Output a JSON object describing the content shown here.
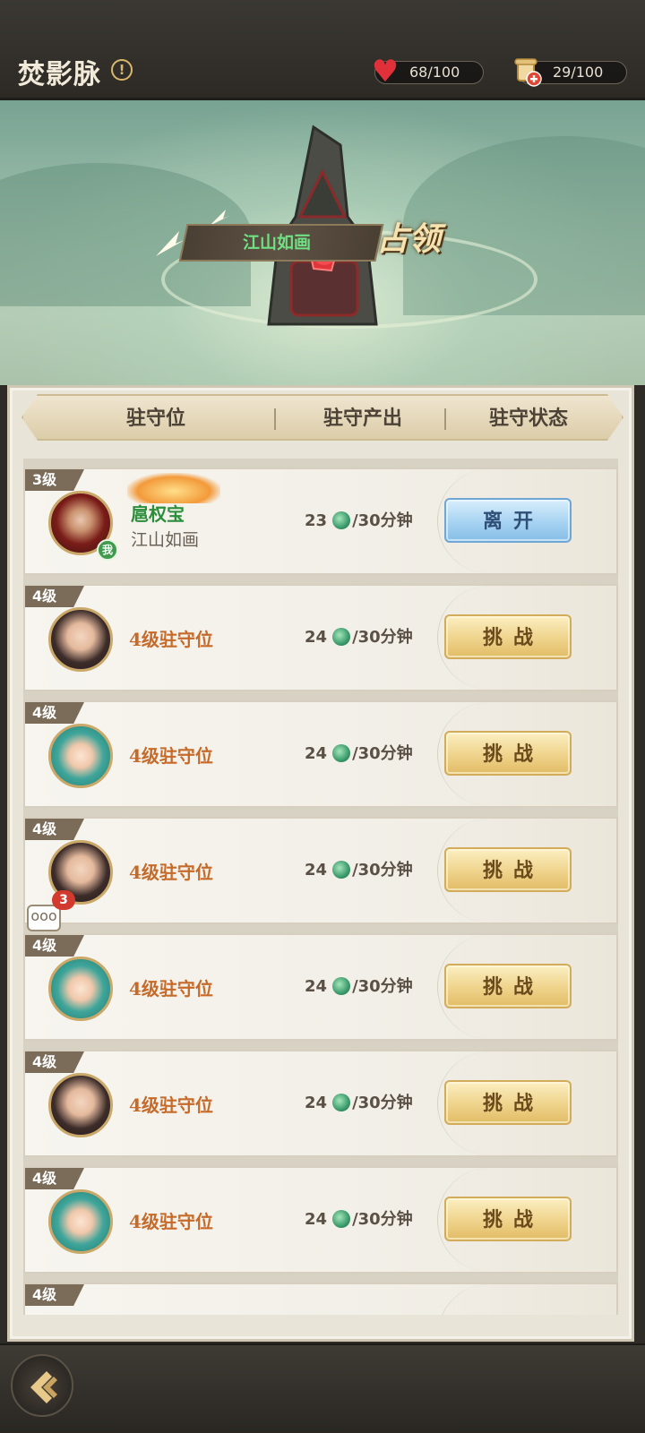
{
  "header": {
    "title": "焚影脉",
    "info_icon": "!",
    "hp_value": "68/100",
    "token_value": "29/100"
  },
  "banner": {
    "owner_name": "江山如画",
    "status_text": "占领"
  },
  "table": {
    "col_slot": "驻守位",
    "col_output": "驻守产出",
    "col_status": "驻守状态"
  },
  "rows": [
    {
      "level": "3级",
      "player_name": "扈权宝",
      "guild": "江山如画",
      "output_amount": "23",
      "output_unit": "/30分钟",
      "button": "离开",
      "me_badge": "我"
    },
    {
      "level": "4级",
      "slot": "4级驻守位",
      "output_amount": "24",
      "output_unit": "/30分钟",
      "button": "挑战"
    },
    {
      "level": "4级",
      "slot": "4级驻守位",
      "output_amount": "24",
      "output_unit": "/30分钟",
      "button": "挑战"
    },
    {
      "level": "4级",
      "slot": "4级驻守位",
      "output_amount": "24",
      "output_unit": "/30分钟",
      "button": "挑战",
      "chat_count": "3",
      "chat_icon": "ooo"
    },
    {
      "level": "4级",
      "slot": "4级驻守位",
      "output_amount": "24",
      "output_unit": "/30分钟",
      "button": "挑战"
    },
    {
      "level": "4级",
      "slot": "4级驻守位",
      "output_amount": "24",
      "output_unit": "/30分钟",
      "button": "挑战"
    },
    {
      "level": "4级",
      "slot": "4级驻守位",
      "output_amount": "24",
      "output_unit": "/30分钟",
      "button": "挑战"
    },
    {
      "level": "4级"
    }
  ],
  "icons": {
    "hp": "heart-icon",
    "token": "scroll-icon",
    "output": "jade-coin-icon",
    "back": "back-arrow-icon"
  },
  "colors": {
    "gold_button": "#efd38b",
    "blue_button": "#a7d3f2",
    "slot_label": "#c66a2a",
    "owner_name": "#6fe083",
    "player_name": "#2b8e3a"
  }
}
